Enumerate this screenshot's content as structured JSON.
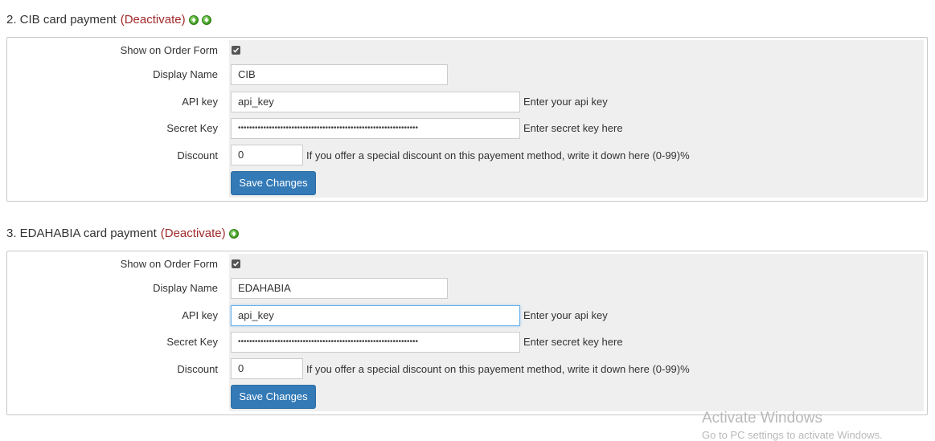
{
  "sections": [
    {
      "title": "2. CIB card payment",
      "deactivate": "(Deactivate)",
      "show_label": "Show on Order Form",
      "display_label": "Display Name",
      "display_value": "CIB",
      "api_label": "API key",
      "api_value": "api_key",
      "api_hint": "Enter your api key",
      "secret_label": "Secret Key",
      "secret_value": "••••••••••••••••••••••••••••••••••••••••••••••••••••••••••••••••",
      "secret_hint": "Enter secret key here",
      "discount_label": "Discount",
      "discount_value": "0",
      "discount_hint": "If you offer a special discount on this payement method, write it down here (0-99)%",
      "save_label": "Save Changes",
      "show_checked": true
    },
    {
      "title": "3. EDAHABIA card payment",
      "deactivate": "(Deactivate)",
      "show_label": "Show on Order Form",
      "display_label": "Display Name",
      "display_value": "EDAHABIA",
      "api_label": "API key",
      "api_value": "api_key",
      "api_hint": "Enter your api key",
      "secret_label": "Secret Key",
      "secret_value": "••••••••••••••••••••••••••••••••••••••••••••••••••••••••••••••••",
      "secret_hint": "Enter secret key here",
      "discount_label": "Discount",
      "discount_value": "0",
      "discount_hint": "If you offer a special discount on this payement method, write it down here (0-99)%",
      "save_label": "Save Changes",
      "show_checked": true
    }
  ],
  "watermark": {
    "line1": "Activate Windows",
    "line2": "Go to PC settings to activate Windows."
  },
  "colors": {
    "deactivate": "#a02a2a",
    "button": "#337ab7",
    "field_bg": "#efefef",
    "arrow_green": "#3c9a1e"
  }
}
